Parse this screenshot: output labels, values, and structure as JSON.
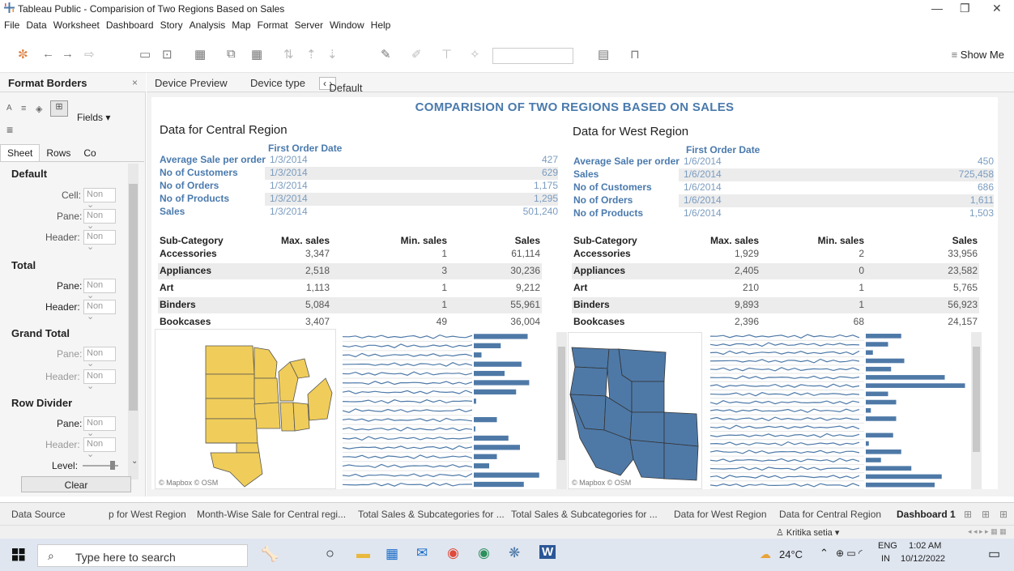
{
  "window": {
    "title": "Tableau Public - Comparision of Two Regions Based on Sales"
  },
  "menu": [
    "File",
    "Data",
    "Worksheet",
    "Dashboard",
    "Story",
    "Analysis",
    "Map",
    "Format",
    "Server",
    "Window",
    "Help"
  ],
  "toolbar": {
    "show_me": "Show Me"
  },
  "left_panel": {
    "title": "Format Borders",
    "fields_label": "Fields",
    "tabs": [
      "Sheet",
      "Rows",
      "Co"
    ],
    "sections": {
      "default": "Default",
      "total": "Total",
      "grand_total": "Grand Total",
      "row_divider": "Row Divider"
    },
    "labels": {
      "cell": "Cell:",
      "pane": "Pane:",
      "header": "Header:",
      "level": "Level:"
    },
    "dropdown_value": "Non",
    "clear": "Clear"
  },
  "device_bar": {
    "preview": "Device Preview",
    "type_label": "Device type",
    "type_value": "Default"
  },
  "dashboard": {
    "title": "COMPARISION OF TWO REGIONS BASED ON SALES",
    "central": {
      "title": "Data for Central Region",
      "fod_header": "First Order Date",
      "kpis": [
        {
          "k": "Average Sale per order",
          "d": "1/3/2014",
          "v": "427"
        },
        {
          "k": "No of Customers",
          "d": "1/3/2014",
          "v": "629"
        },
        {
          "k": "No of Orders",
          "d": "1/3/2014",
          "v": "1,175"
        },
        {
          "k": "No of Products",
          "d": "1/3/2014",
          "v": "1,295"
        },
        {
          "k": "Sales",
          "d": "1/3/2014",
          "v": "501,240"
        }
      ],
      "table_headers": [
        "Sub-Category",
        "Max. sales",
        "Min. sales",
        "Sales"
      ],
      "rows": [
        [
          "Accessories",
          "3,347",
          "1",
          "61,114"
        ],
        [
          "Appliances",
          "2,518",
          "3",
          "30,236"
        ],
        [
          "Art",
          "1,113",
          "1",
          "9,212"
        ],
        [
          "Binders",
          "5,084",
          "1",
          "55,961"
        ],
        [
          "Bookcases",
          "3,407",
          "49",
          "36,004"
        ]
      ],
      "map_caption": "© Mapbox © OSM"
    },
    "west": {
      "title": "Data for West Region",
      "fod_header": "First Order Date",
      "kpis": [
        {
          "k": "Average Sale per order",
          "d": "1/6/2014",
          "v": "450"
        },
        {
          "k": "Sales",
          "d": "1/6/2014",
          "v": "725,458"
        },
        {
          "k": "No of Customers",
          "d": "1/6/2014",
          "v": "686"
        },
        {
          "k": "No of Orders",
          "d": "1/6/2014",
          "v": "1,611"
        },
        {
          "k": "No of Products",
          "d": "1/6/2014",
          "v": "1,503"
        }
      ],
      "table_headers": [
        "Sub-Category",
        "Max. sales",
        "Min. sales",
        "Sales"
      ],
      "rows": [
        [
          "Accessories",
          "1,929",
          "2",
          "33,956"
        ],
        [
          "Appliances",
          "2,405",
          "0",
          "23,582"
        ],
        [
          "Art",
          "210",
          "1",
          "5,765"
        ],
        [
          "Binders",
          "9,893",
          "1",
          "56,923"
        ],
        [
          "Bookcases",
          "2,396",
          "68",
          "24,157"
        ]
      ],
      "map_caption": "© Mapbox © OSM"
    }
  },
  "bottom_tabs": [
    "Data Source",
    "p for West Region",
    "Month-Wise Sale for Central regi...",
    "Total Sales & Subcategories for ...",
    "Total Sales & Subcategories for ...",
    "Data for West Region",
    "Data for Central Region",
    "Dashboard 1"
  ],
  "status": {
    "user": "Kritika setia"
  },
  "taskbar": {
    "search_placeholder": "Type here to search",
    "weather": "24°C",
    "lang": "ENG",
    "lang2": "IN",
    "time": "1:02 AM",
    "date": "10/12/2022"
  },
  "colors": {
    "central_map": "#f0cd5a",
    "west_map": "#4e79a7",
    "bars": "#4e79a7",
    "accent": "#4a7aad"
  },
  "bars_central": [
    0.7,
    0.35,
    0.1,
    0.62,
    0.4,
    0.72,
    0.55,
    0.03,
    0.0,
    0.3,
    0.02,
    0.45,
    0.6,
    0.3,
    0.2,
    0.85,
    0.65
  ],
  "bars_west": [
    0.35,
    0.22,
    0.07,
    0.38,
    0.25,
    0.78,
    0.98,
    0.22,
    0.3,
    0.05,
    0.3,
    0.0,
    0.27,
    0.03,
    0.35,
    0.15,
    0.45,
    0.75,
    0.68
  ]
}
